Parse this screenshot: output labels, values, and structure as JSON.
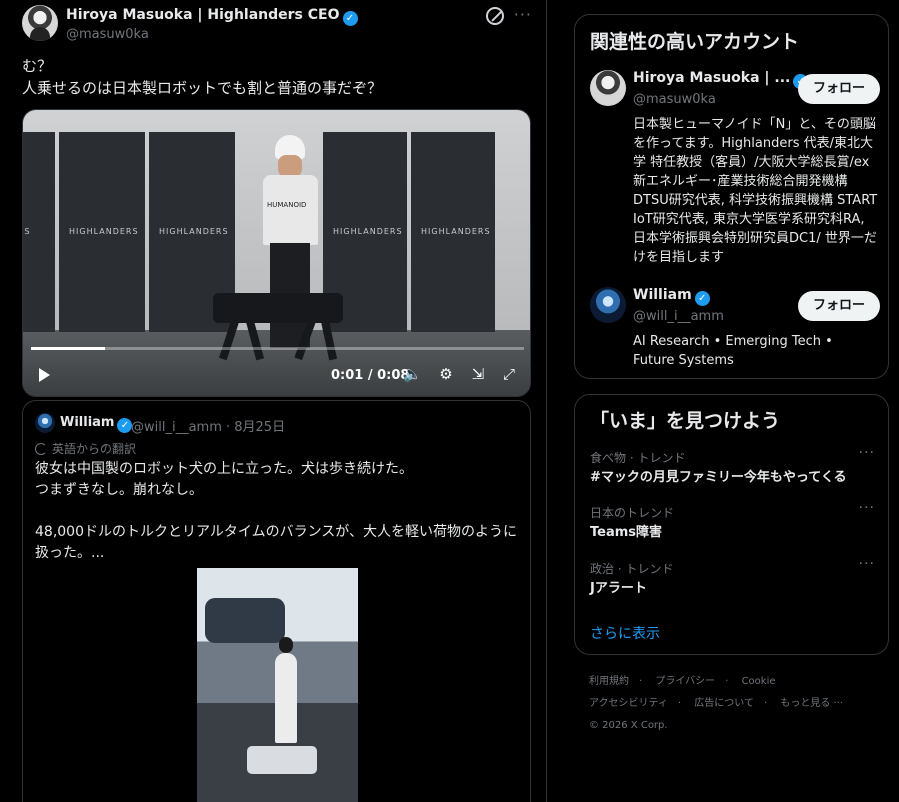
{
  "tweet": {
    "author_name": "Hiroya Masuoka | Highlanders CEO",
    "author_handle": "@masuw0ka",
    "more": "···",
    "text_line1": "む？",
    "text_line2": "人乗せるのは日本製ロボットでも割と普通の事だぞ？"
  },
  "video": {
    "time": "0:01 / 0:08",
    "panel_label": "HIGHLANDERS",
    "shirt_text": "HUMANOID",
    "progress": 0.15
  },
  "quote": {
    "author_name": "William",
    "meta": "@will_i__amm · 8月25日",
    "translated_label": "英語からの翻訳",
    "text_line1": "彼女は中国製のロボット犬の上に立った。犬は歩き続けた。",
    "text_line2": "つまずきなし。崩れなし。",
    "text_line3": "48,000ドルのトルクとリアルタイムのバランスが、大人を軽い荷物のように扱った。..."
  },
  "related": {
    "title": "関連性の高いアカウント",
    "follow_label": "フォロー",
    "accounts": [
      {
        "name": "Hiroya Masuoka | ...",
        "handle": "@masuw0ka",
        "bio": "日本製ヒューマノイド「N」と、その頭脳を作ってます。Highlanders 代表/東北大学 特任教授（客員）/大阪大学総長賞/ex 新エネルギー･産業技術総合開発機構 DTSU研究代表, 科学技術振興機構 START IoT研究代表, 東京大学医学系研究科RA, 日本学術振興会特別研究員DC1/ 世界一だけを目指します"
      },
      {
        "name": "William",
        "handle": "@will_i__amm",
        "bio": "AI Research • Emerging Tech • Future Systems"
      }
    ]
  },
  "trends": {
    "title": "「いま」を見つけよう",
    "items": [
      {
        "category": "食べ物 · トレンド",
        "name": "#マックの月見ファミリー今年もやってくる"
      },
      {
        "category": "日本のトレンド",
        "name": "Teams障害"
      },
      {
        "category": "政治 · トレンド",
        "name": "Jアラート"
      }
    ],
    "show_more": "さらに表示",
    "more": "···"
  },
  "footer": {
    "links_row1": [
      "利用規約",
      "プライバシー",
      "Cookie"
    ],
    "links_row2": [
      "アクセシビリティ",
      "広告について",
      "もっと見る ···"
    ],
    "copyright": "© 2026 X Corp."
  },
  "colors": {
    "accent": "#1d9bf0",
    "background": "#000000",
    "border": "#2f3336",
    "muted": "#71767b"
  }
}
